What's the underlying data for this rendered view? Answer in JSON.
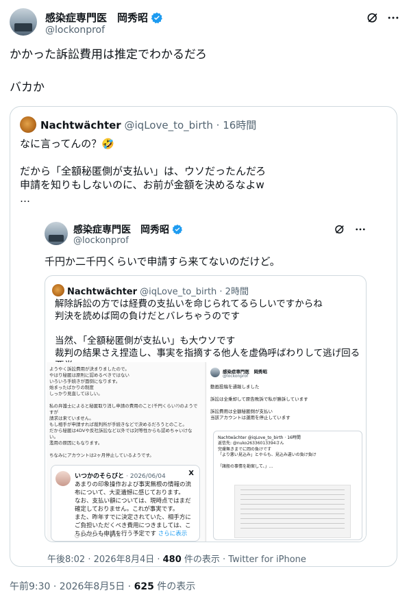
{
  "tweet": {
    "display_name": "感染症専門医　岡秀昭",
    "handle": "@lockonprof",
    "text": "かかった訴訟費用は推定でわかるだろ\n\nバカか",
    "timestamp": "午前9:30 · 2026年8月5日 · ",
    "views_count": "625",
    "views_label": " 件の表示"
  },
  "quote1": {
    "display_name": "Nachtwächter",
    "handle": "@iqLove_to_birth",
    "time": "· 16時間",
    "text": "なに言ってんの？🤣\n\nだから「全額秘匿側が支払い」は、ウソだったんだろ\n申請を知りもしないのに、お前が金額を決めるなよw\n…"
  },
  "quote2": {
    "display_name": "感染症専門医　岡秀昭",
    "handle": "@lockonprof",
    "text": "千円か二千円くらいで申請すら来てないのだけど。",
    "meta_time": "午後8:02 · 2026年8月4日 · ",
    "meta_views": "480",
    "meta_views_label": " 件の表示 · ",
    "meta_source": "Twitter for iPhone"
  },
  "quote3": {
    "display_name": "Nachtwächter",
    "handle": "@iqLove_to_birth",
    "time": "· 2時間",
    "text": "解除訴訟の方では経費の支払いを命じられてるらしいですからね\n判決を読めば岡の負けだとバレちゃうのです\n\n当然、「全額秘匿側が支払い」も大ウソです\n裁判の結果さえ捏造し、事実を指摘する他人を虚偽呼ばわりして逃げ回る悪党…"
  },
  "media": {
    "left_text": "ようやく訴訟費用が決まりましたので。\nやはり秘匿は原則に認めるべきではない\nいろいろ手続きが面倒になります。\n始まったばかりの制度\nしっかり見直してほしい。\n\n私の弁護士によると秘匿取り消し申請の費用のこと(千円くらい?)のようですが\n請求は来ていません。\nもし相手が申請すれば裁判所が手続きなどで決めるだろうとのこと。\nだから秘匿は4DVや反社訴訟など以外では対等性からも認めちゃいけない。\n濫用の原因にもなります。\n\nちなみにアカウントは2ヶ月停止しているようです。",
    "card_name": "いつかのそらびと",
    "card_date": "· 2026/06/04",
    "card_x": "X",
    "card_text": "あまりの印象操作および事実無根の情報の流布について、大変遺憾に感じております。\nなお、支払い額については、現時点ではまだ確定しておりません。これが事実です。\nまた、昨年すでに決定されていた、相手方にご負担いただくべき費用につきましては、こちらからも申請を行う予定です",
    "card_more": "さらに表示",
    "card_stats": "◯ 8    ⟳ 31    ♡ 177    ▮ 3万",
    "right_name": "感染症専門医　岡秀昭",
    "right_handle": "@lockonprof",
    "right_text": "動画投稿を通報しました\n\n訴訟は全乗却して原告敗訴で私が勝訴しています\n\n訴訟費用は全額秘匿側が支払い\n当該アカウントは運用を停止しています",
    "inner_name": "Nachtwächter @iqLove_to_birth · 16時間",
    "inner_text": "返信先: @nuko26336013394さん\n完膚無きまでに岡の負けです\n「より悪い見込み」とやらも、見込み違いの負け負け\n\n「諸般の事情を勘案して、」…"
  },
  "colors": {
    "verified": "#1d9bf0",
    "border": "#cfd9de",
    "muted": "#536471"
  },
  "icons": [
    "verified-badge-icon",
    "grok-icon",
    "more-icon"
  ]
}
